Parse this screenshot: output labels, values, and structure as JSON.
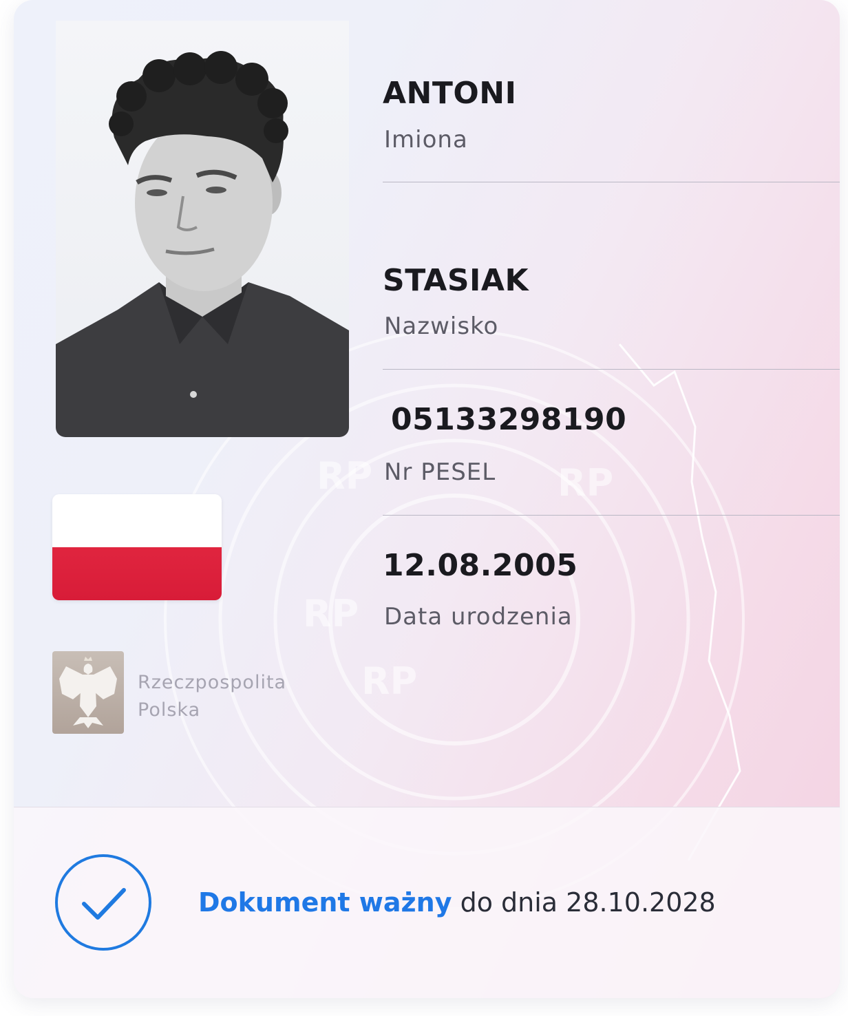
{
  "colors": {
    "accent": "#1f78e6",
    "flag_white": "#ffffff",
    "flag_red": "#dc2039"
  },
  "fields": [
    {
      "value": "ANTONI",
      "label": "Imiona"
    },
    {
      "value": "STASIAK",
      "label": "Nazwisko"
    },
    {
      "value": "05133298190",
      "label": "Nr PESEL"
    },
    {
      "value": "12.08.2005",
      "label": "Data urodzenia"
    }
  ],
  "emblem": {
    "icon": "polish-eagle-emblem-icon",
    "line1": "Rzeczpospolita",
    "line2": "Polska"
  },
  "watermark": {
    "text": "RP"
  },
  "footer": {
    "status_icon": "checkmark-circle-icon",
    "valid_label": "Dokument ważny",
    "valid_until": "do dnia 28.10.2028"
  }
}
